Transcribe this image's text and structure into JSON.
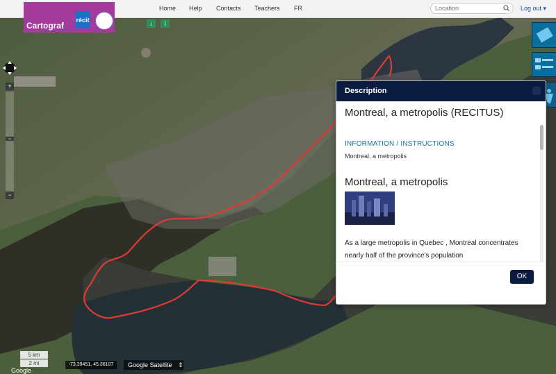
{
  "nav": {
    "brand": "Cartograf",
    "brand_badge": "récit",
    "links": [
      "Home",
      "Help",
      "Contacts",
      "Teachers",
      "FR"
    ],
    "search_placeholder": "Location",
    "logout": "Log out ▾"
  },
  "map": {
    "coordinates": "-73.39451, 45.36107",
    "scale": [
      "5 km",
      "2 mi"
    ],
    "base_layer": "Google Satellite",
    "attribution": "Google"
  },
  "modal": {
    "title": "Description",
    "heading": "Montreal, a metropolis (RECITUS)",
    "info_label": "INFORMATION / INSTRUCTIONS",
    "info_text": "Montreal, a metropolis",
    "section_title": "Montreal, a metropolis",
    "body": "As a large metropolis in Quebec , Montreal concentrates nearly half of the province's population",
    "ok": "OK"
  },
  "icons": {
    "pan": "pan-icon",
    "zoom_in": "zoom-in-icon",
    "zoom_out": "zoom-out-icon",
    "search": "search-icon",
    "layers": "layers-icon"
  }
}
